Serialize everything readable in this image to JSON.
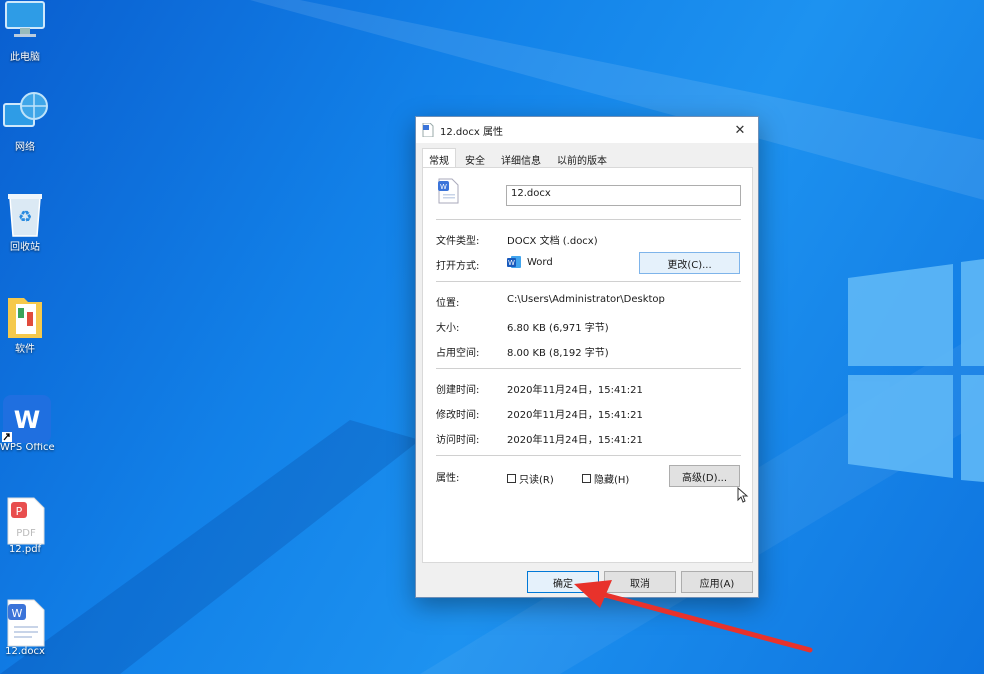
{
  "desktop": {
    "icons": [
      {
        "label": "此电脑",
        "icon": "computer-icon"
      },
      {
        "label": "网络",
        "icon": "network-icon"
      },
      {
        "label": "回收站",
        "icon": "recycle-bin-icon"
      },
      {
        "label": "软件",
        "icon": "folder-icon"
      },
      {
        "label": "WPS Office",
        "icon": "wps-office-icon"
      },
      {
        "label": "12.pdf",
        "icon": "pdf-file-icon"
      },
      {
        "label": "12.docx",
        "icon": "docx-file-icon"
      }
    ]
  },
  "dialog": {
    "title": "12.docx 属性",
    "close_glyph": "✕",
    "tabs": [
      "常规",
      "安全",
      "详细信息",
      "以前的版本"
    ],
    "file_name": "12.docx",
    "type_label": "文件类型:",
    "type_value": "DOCX 文档 (.docx)",
    "open_with_label": "打开方式:",
    "open_with_value": "Word",
    "change_button": "更改(C)...",
    "location_label": "位置:",
    "location_value": "C:\\Users\\Administrator\\Desktop",
    "size_label": "大小:",
    "size_value": "6.80 KB (6,971 字节)",
    "disk_size_label": "占用空间:",
    "disk_size_value": "8.00 KB (8,192 字节)",
    "created_label": "创建时间:",
    "created_value": "2020年11月24日，15:41:21",
    "modified_label": "修改时间:",
    "modified_value": "2020年11月24日，15:41:21",
    "accessed_label": "访问时间:",
    "accessed_value": "2020年11月24日，15:41:21",
    "attributes_label": "属性:",
    "readonly_label": "只读(R)",
    "hidden_label": "隐藏(H)",
    "advanced_button": "高级(D)...",
    "ok_button": "确定",
    "cancel_button": "取消",
    "apply_button": "应用(A)"
  },
  "colors": {
    "desktop_bg": "#1281e8",
    "annotation_arrow": "#e8322b",
    "focus_border": "#0078d7"
  }
}
